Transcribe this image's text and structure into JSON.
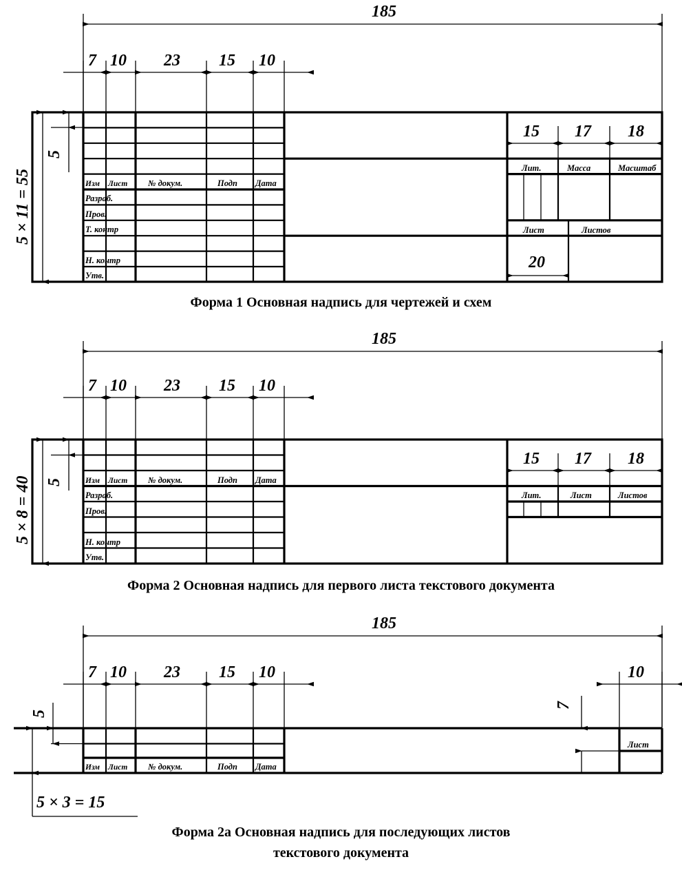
{
  "document": {
    "title": "ГОСТ основные надписи — Формы 1, 2, 2а",
    "ink_color": "#000000",
    "paper_color": "#ffffff"
  },
  "common": {
    "total_width_dim": "185",
    "column_dims": [
      "7",
      "10",
      "23",
      "15",
      "10"
    ],
    "right_block_dims": [
      "15",
      "17",
      "18"
    ],
    "row_height_dim": "5",
    "columns_labels": [
      "Изм",
      "Лист",
      "№ докум.",
      "Подп",
      "Дата"
    ]
  },
  "form1": {
    "caption": "Форма 1  Основная надпись для чертежей и схем",
    "height_dim": "5 × 11 = 55",
    "row_height_dim": "5",
    "total_width_dim": "185",
    "column_dims": [
      "7",
      "10",
      "23",
      "15",
      "10"
    ],
    "right_block_dims": [
      "15",
      "17",
      "18"
    ],
    "header_row": [
      "Изм",
      "Лист",
      "№ докум.",
      "Подп",
      "Дата"
    ],
    "role_rows": [
      "Разраб.",
      "Пров.",
      "Т. контр",
      "",
      "Н. контр",
      "Утв."
    ],
    "right_labels_top": [
      "Лит.",
      "Масса",
      "Масштаб"
    ],
    "right_labels_bottom": [
      "Лист",
      "Листов"
    ],
    "bottom_dim": "20"
  },
  "form2": {
    "caption": "Форма 2  Основная надпись для первого листа текстового документа",
    "height_dim": "5 × 8 = 40",
    "row_height_dim": "5",
    "total_width_dim": "185",
    "column_dims": [
      "7",
      "10",
      "23",
      "15",
      "10"
    ],
    "right_block_dims": [
      "15",
      "17",
      "18"
    ],
    "header_row": [
      "Изм",
      "Лист",
      "№ докум.",
      "Подп",
      "Дата"
    ],
    "role_rows": [
      "Разраб.",
      "Пров.",
      "",
      "Н. контр",
      "Утв."
    ],
    "right_labels": [
      "Лит.",
      "Лист",
      "Листов"
    ]
  },
  "form2a": {
    "caption_line1": "Форма 2а  Основная надпись для последующих листов",
    "caption_line2": "текстового документа",
    "height_dim": "5 × 3 = 15",
    "row_height_dim": "5",
    "total_width_dim": "185",
    "column_dims": [
      "7",
      "10",
      "23",
      "15",
      "10"
    ],
    "right_dim_horizontal": "10",
    "right_dim_vertical": "7",
    "header_row": [
      "Изм",
      "Лист",
      "№ докум.",
      "Подп",
      "Дата"
    ],
    "right_label": "Лист"
  }
}
